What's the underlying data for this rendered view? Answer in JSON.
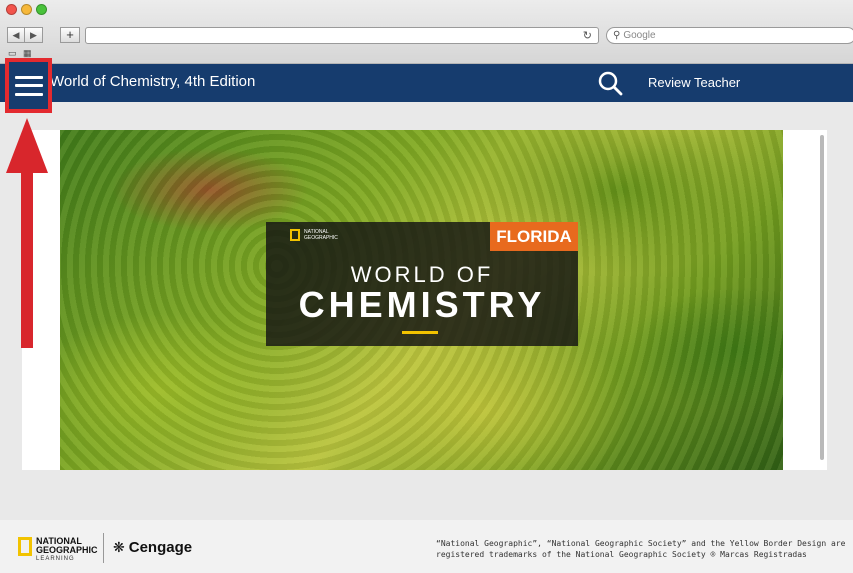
{
  "browser": {
    "search_placeholder": "Google",
    "reload_glyph": "↻",
    "back_glyph": "◀",
    "forward_glyph": "▶",
    "new_tab_glyph": "+",
    "bookmarks_glyph": "▭ ▦"
  },
  "header": {
    "title": "World of Chemistry, 4th Edition",
    "user": "Review Teacher",
    "background": "#163c6e"
  },
  "cover": {
    "brand": "NATIONAL GEOGRAPHIC",
    "edition_badge": "FLORIDA",
    "line1": "WORLD OF",
    "line2": "CHEMISTRY",
    "badge_color": "#e86a1e"
  },
  "footer": {
    "ng_line1": "NATIONAL",
    "ng_line2": "GEOGRAPHIC",
    "ng_line3": "LEARNING",
    "cengage": "Cengage",
    "legal": "“National Geographic”, “National Geographic Society” and the Yellow Border Design are registered trademarks of the National Geographic Society ® Marcas Registradas"
  },
  "annotation": {
    "highlight_color": "#e32a2f"
  }
}
